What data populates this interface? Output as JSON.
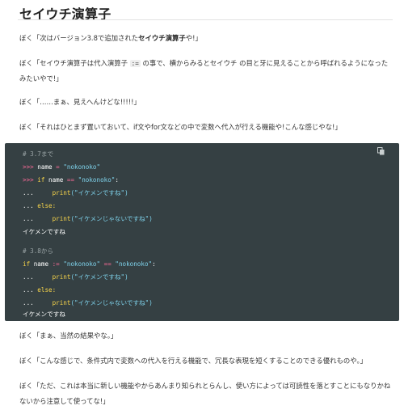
{
  "heading": "セイウチ演算子",
  "p1": {
    "prefix": "ぼく「次はバージョン3.8で追加された",
    "bold": "セイウチ演算子",
    "suffix": "や!」"
  },
  "p2": {
    "prefix": "ぼく「セイウチ演算子は代入演算子 ",
    "code": ":=",
    "line1_rest": " の事で、横からみるとセイウチ の目と牙に見えることから呼ばれるようになった",
    "line2": "みたいやで!」"
  },
  "p3": "ぼく「……まぁ、見えへんけどな!!!!!」",
  "p4": "ぼく「それはひとまず置いておいて、if文やfor文などの中で変数へ代入が行える機能や!こんな感じやな!」",
  "code": {
    "copy_icon": "copy-icon",
    "comment1": "# 3.7まで",
    "l2_prompt": ">>>",
    "l2_var": "name",
    "l2_eq": "=",
    "l2_str": "\"nokonoko\"",
    "l3_prompt": ">>>",
    "l3_kw": "if",
    "l3_var": "name",
    "l3_eq": "==",
    "l3_str": "\"nokonoko\"",
    "l3_colon": ":",
    "l4_prompt": "...",
    "l4_func": "print",
    "l4_str": "(\"イケメンですね\")",
    "l5_prompt": "...",
    "l5_kw": "else:",
    "l6_prompt": "...",
    "l6_func": "print",
    "l6_str": "(\"イケメンじゃないですね\")",
    "out1": "イケメンですね",
    "comment2": "# 3.8から",
    "l9_kw": "if",
    "l9_var": "name",
    "l9_walrus": ":=",
    "l9_str1": "\"nokonoko\"",
    "l9_eq": "==",
    "l9_str2": "\"nokonoko\"",
    "l9_colon": ":",
    "l10_prompt": "...",
    "l10_func": "print",
    "l10_str": "(\"イケメンですね\")",
    "l11_prompt": "...",
    "l11_kw": "else:",
    "l12_prompt": "...",
    "l12_func": "print",
    "l12_str": "(\"イケメンじゃないですね\")",
    "out2": "イケメンですね"
  },
  "p5": "ぼく「まぁ、当然の結果やな。」",
  "p6": "ぼく「こんな感じで、条件式内で変数への代入を行える機能で、冗長な表現を短くすることのできる優れものや。」",
  "p7": {
    "line1": "ぼく「ただ、これは本当に新しい機能やからあんまり知られとらんし、使い方によっては可読性を落とすことにもなりかね",
    "line2": "ないから注意して使ってな!」"
  }
}
